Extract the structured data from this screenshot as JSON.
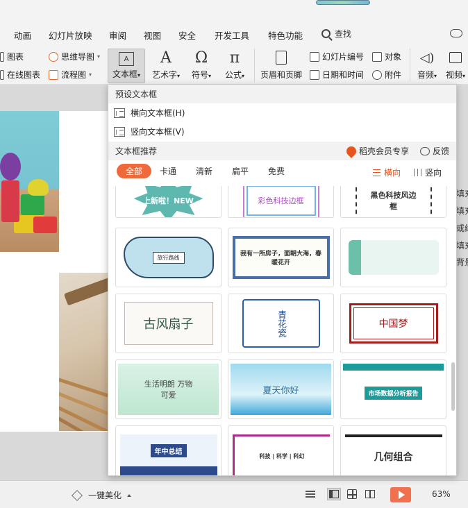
{
  "menu": {
    "tabs": [
      "动画",
      "幻灯片放映",
      "审阅",
      "视图",
      "安全",
      "开发工具",
      "特色功能"
    ],
    "search_label": "查找"
  },
  "ribbon": {
    "left_items": [
      "图表",
      "在线图表"
    ],
    "mid_items": [
      "思维导图",
      "流程图"
    ],
    "textbox_label": "文本框",
    "art_label": "艺术字",
    "symbol_label": "符号",
    "formula_label": "公式",
    "header_footer_label": "页眉和页脚",
    "slide_number_label": "幻灯片编号",
    "datetime_label": "日期和时间",
    "object_label": "对象",
    "attachment_label": "附件",
    "audio_label": "音频",
    "video_label": "视频"
  },
  "textbox_menu": {
    "preset_header": "预设文本框",
    "horizontal_label": "横向文本框(H)",
    "vertical_label": "竖向文本框(V)",
    "recommend_header": "文本框推荐",
    "vip_label": "稻壳会员专享",
    "feedback_label": "反馈",
    "filters": [
      "全部",
      "卡通",
      "清新",
      "扁平",
      "免费"
    ],
    "orientation": {
      "horizontal": "横向",
      "vertical": "竖向"
    },
    "templates": [
      {
        "text": "上新啦！NEW"
      },
      {
        "text": "彩色科技边框"
      },
      {
        "text": "黑色科技风边框"
      },
      {
        "text": "旅行路线"
      },
      {
        "text": "我有一所房子，面朝大海，春暖花开"
      },
      {
        "text": ""
      },
      {
        "text": "古风扇子"
      },
      {
        "text": "青花瓷"
      },
      {
        "text": "中国梦"
      },
      {
        "text": "生活明朗 万物可爱"
      },
      {
        "text": "夏天你好"
      },
      {
        "text": "市场数据分析报告"
      },
      {
        "text": "年中总结"
      },
      {
        "text": "科技 | 科学 | 科幻"
      },
      {
        "text": "几何组合"
      }
    ]
  },
  "side_notes": [
    "填充",
    "填充",
    "或线",
    "填充",
    "背景"
  ],
  "statusbar": {
    "beautify_label": "一键美化",
    "zoom": "63%"
  }
}
